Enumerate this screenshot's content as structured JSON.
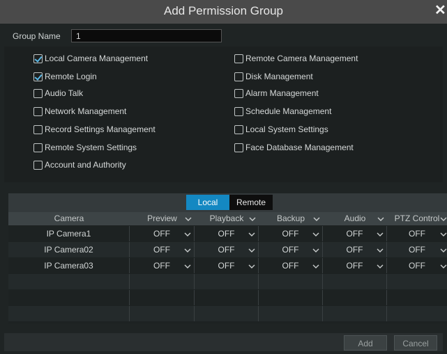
{
  "dialog": {
    "title": "Add Permission Group"
  },
  "group": {
    "label": "Group Name",
    "value": "1"
  },
  "permissions_left": [
    {
      "label": "Local Camera Management",
      "checked": true
    },
    {
      "label": "Remote Login",
      "checked": true
    },
    {
      "label": "Audio Talk",
      "checked": false
    },
    {
      "label": "Network Management",
      "checked": false
    },
    {
      "label": "Record Settings Management",
      "checked": false
    },
    {
      "label": "Remote System Settings",
      "checked": false
    },
    {
      "label": "Account and Authority",
      "checked": false
    }
  ],
  "permissions_right": [
    {
      "label": "Remote Camera Management",
      "checked": false
    },
    {
      "label": "Disk Management",
      "checked": false
    },
    {
      "label": "Alarm Management",
      "checked": false
    },
    {
      "label": "Schedule Management",
      "checked": false
    },
    {
      "label": "Local System Settings",
      "checked": false
    },
    {
      "label": "Face Database Management",
      "checked": false
    }
  ],
  "tabs": [
    {
      "label": "Local",
      "active": true
    },
    {
      "label": "Remote",
      "active": false
    }
  ],
  "table": {
    "headers": [
      "Camera",
      "Preview",
      "Playback",
      "Backup",
      "Audio",
      "PTZ Control"
    ],
    "rows": [
      [
        "IP Camera1",
        "OFF",
        "OFF",
        "OFF",
        "OFF",
        "OFF"
      ],
      [
        "IP Camera02",
        "OFF",
        "OFF",
        "OFF",
        "OFF",
        "OFF"
      ],
      [
        "IP Camera03",
        "OFF",
        "OFF",
        "OFF",
        "OFF",
        "OFF"
      ]
    ]
  },
  "buttons": {
    "add": "Add",
    "cancel": "Cancel"
  },
  "colors": {
    "accent": "#1488c2",
    "check": "#5ab8e6"
  }
}
